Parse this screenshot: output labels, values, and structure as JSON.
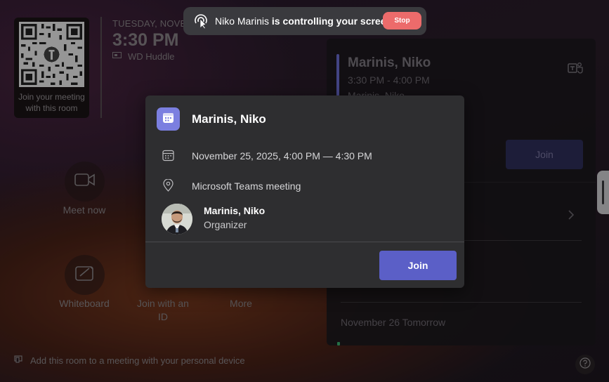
{
  "qr": {
    "caption": "Join your meeting with this room"
  },
  "header": {
    "date": "TUESDAY, NOVEM",
    "time": "3:30 PM",
    "room": "WD Huddle"
  },
  "banner": {
    "controller": "Niko Marinis",
    "message": " is controlling your screen",
    "stop_label": "Stop"
  },
  "panel": {
    "meeting_title": "Marinis, Niko",
    "meeting_time": "3:30 PM - 4:00 PM",
    "meeting_organizer": "Marinis, Niko",
    "join_label": "Join",
    "next_day": "November 26 Tomorrow"
  },
  "actions": {
    "meet_now": "Meet now",
    "whiteboard": "Whiteboard",
    "join_with_id": "Join with an ID",
    "more": "More"
  },
  "footer": {
    "message": "Add this room to a meeting with your personal device"
  },
  "modal": {
    "title": "Marinis, Niko",
    "datetime": "November 25, 2025, 4:00 PM — 4:30 PM",
    "location": "Microsoft Teams meeting",
    "organizer_name": "Marinis, Niko",
    "organizer_role": "Organizer",
    "join_label": "Join"
  },
  "colors": {
    "accent": "#5b5fc7",
    "stop": "#ec6b6b",
    "calendar_badge": "#7b7fe0"
  }
}
